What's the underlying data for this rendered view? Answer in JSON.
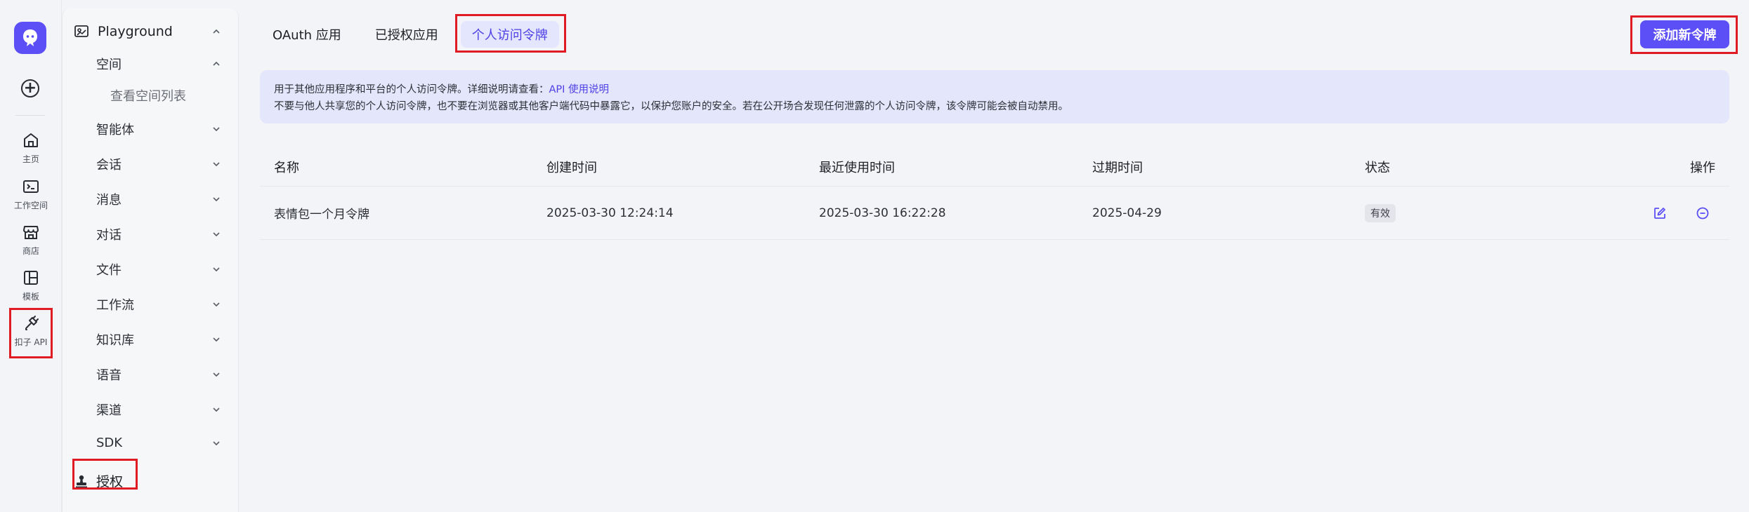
{
  "rail": {
    "items": [
      {
        "label": "主页",
        "icon": "home-icon"
      },
      {
        "label": "工作空间",
        "icon": "workspace-icon"
      },
      {
        "label": "商店",
        "icon": "store-icon"
      },
      {
        "label": "模板",
        "icon": "template-icon"
      },
      {
        "label": "扣子 API",
        "icon": "api-plug-icon"
      }
    ]
  },
  "sidebar": {
    "top": "Playground",
    "space": "空间",
    "space_sub": "查看空间列表",
    "items": [
      "智能体",
      "会话",
      "消息",
      "对话",
      "文件",
      "工作流",
      "知识库",
      "语音",
      "渠道",
      "SDK"
    ],
    "auth": "授权"
  },
  "tabs": [
    "OAuth 应用",
    "已授权应用",
    "个人访问令牌"
  ],
  "active_tab": "个人访问令牌",
  "add_button": "添加新令牌",
  "notice": {
    "line1": "用于其他应用程序和平台的个人访问令牌。详细说明请查看：",
    "link": "API 使用说明",
    "line2": "不要与他人共享您的个人访问令牌，也不要在浏览器或其他客户端代码中暴露它，以保护您账户的安全。若在公开场合发现任何泄露的个人访问令牌，该令牌可能会被自动禁用。"
  },
  "table": {
    "headers": [
      "名称",
      "创建时间",
      "最近使用时间",
      "过期时间",
      "状态",
      "操作"
    ],
    "rows": [
      {
        "name": "表情包一个月令牌",
        "created": "2025-03-30 12:24:14",
        "last_used": "2025-03-30 16:22:28",
        "expires": "2025-04-29",
        "status": "有效"
      }
    ]
  },
  "colors": {
    "accent": "#5b4ff5",
    "highlight": "#e01b24",
    "notice_bg": "#e4e6fc"
  }
}
